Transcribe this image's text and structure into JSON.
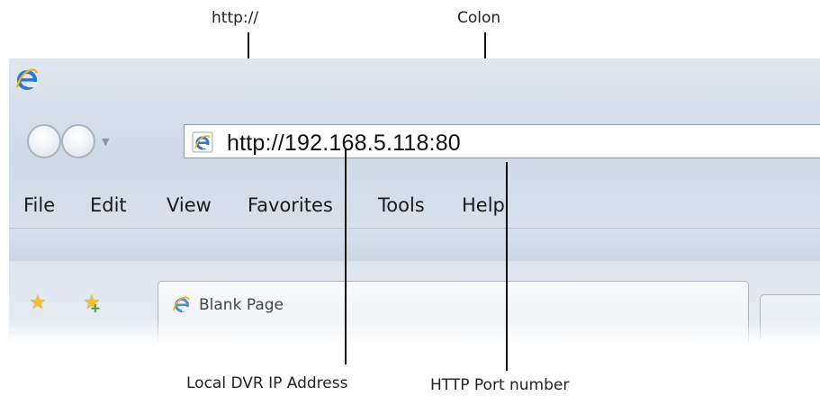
{
  "callouts": {
    "http": "http://",
    "colon": "Colon",
    "ip": "Local DVR IP Address",
    "port": "HTTP Port number"
  },
  "address_bar": {
    "url_main": "http://192.168.5.118:",
    "url_port": "80"
  },
  "menu": {
    "items": [
      "File",
      "Edit",
      "View",
      "Favorites",
      "Tools",
      "Help"
    ]
  },
  "tab": {
    "label": "Blank Page"
  },
  "icons": {
    "browser_logo": "ie-logo-icon",
    "star_favorites": "star-icon",
    "star_add": "add-favorite-star-icon"
  }
}
